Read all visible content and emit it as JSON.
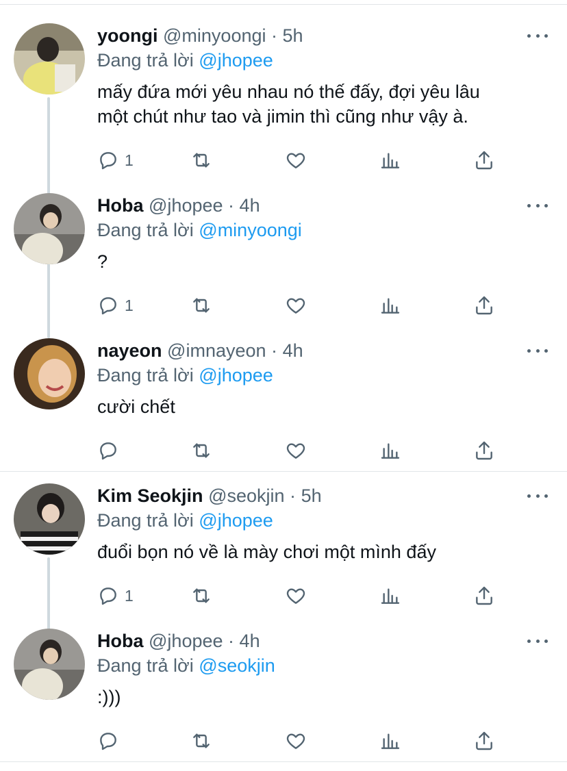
{
  "tweets": [
    {
      "name": "yoongi",
      "handle": "@minyoongi",
      "time": "5h",
      "reply_prefix": "Đang trả lời",
      "reply_to": "@jhopee",
      "text_lines": [
        "mấy đứa mới yêu nhau nó thế đấy, đợi yêu lâu",
        "một chút như tao và jimin thì cũng như vậy à."
      ],
      "reply_count": "1",
      "avatar_color": "#b9b090"
    },
    {
      "name": "Hoba",
      "handle": "@jhopee",
      "time": "4h",
      "reply_prefix": "Đang trả lời",
      "reply_to": "@minyoongi",
      "text_lines": [
        "?"
      ],
      "reply_count": "1",
      "avatar_color": "#8a8a86"
    },
    {
      "name": "nayeon",
      "handle": "@imnayeon",
      "time": "4h",
      "reply_prefix": "Đang trả lời",
      "reply_to": "@jhopee",
      "text_lines": [
        "cười chết"
      ],
      "reply_count": "",
      "avatar_color": "#c79a62"
    },
    {
      "name": "Kim Seokjin",
      "handle": "@seokjin",
      "time": "5h",
      "reply_prefix": "Đang trả lời",
      "reply_to": "@jhopee",
      "text_lines": [
        "đuổi bọn nó về là mày chơi một mình đấy"
      ],
      "reply_count": "1",
      "avatar_color": "#3a3a3a"
    },
    {
      "name": "Hoba",
      "handle": "@jhopee",
      "time": "4h",
      "reply_prefix": "Đang trả lời",
      "reply_to": "@seokjin",
      "text_lines": [
        ":)))"
      ],
      "reply_count": "",
      "avatar_color": "#8a8a86"
    }
  ],
  "separator": "·",
  "icons": [
    "reply-icon",
    "retweet-icon",
    "like-icon",
    "analytics-icon",
    "share-icon",
    "more-icon"
  ],
  "colors": {
    "mention": "#1d9bf0",
    "muted": "#536471",
    "thread_line": "#cfd9de"
  }
}
